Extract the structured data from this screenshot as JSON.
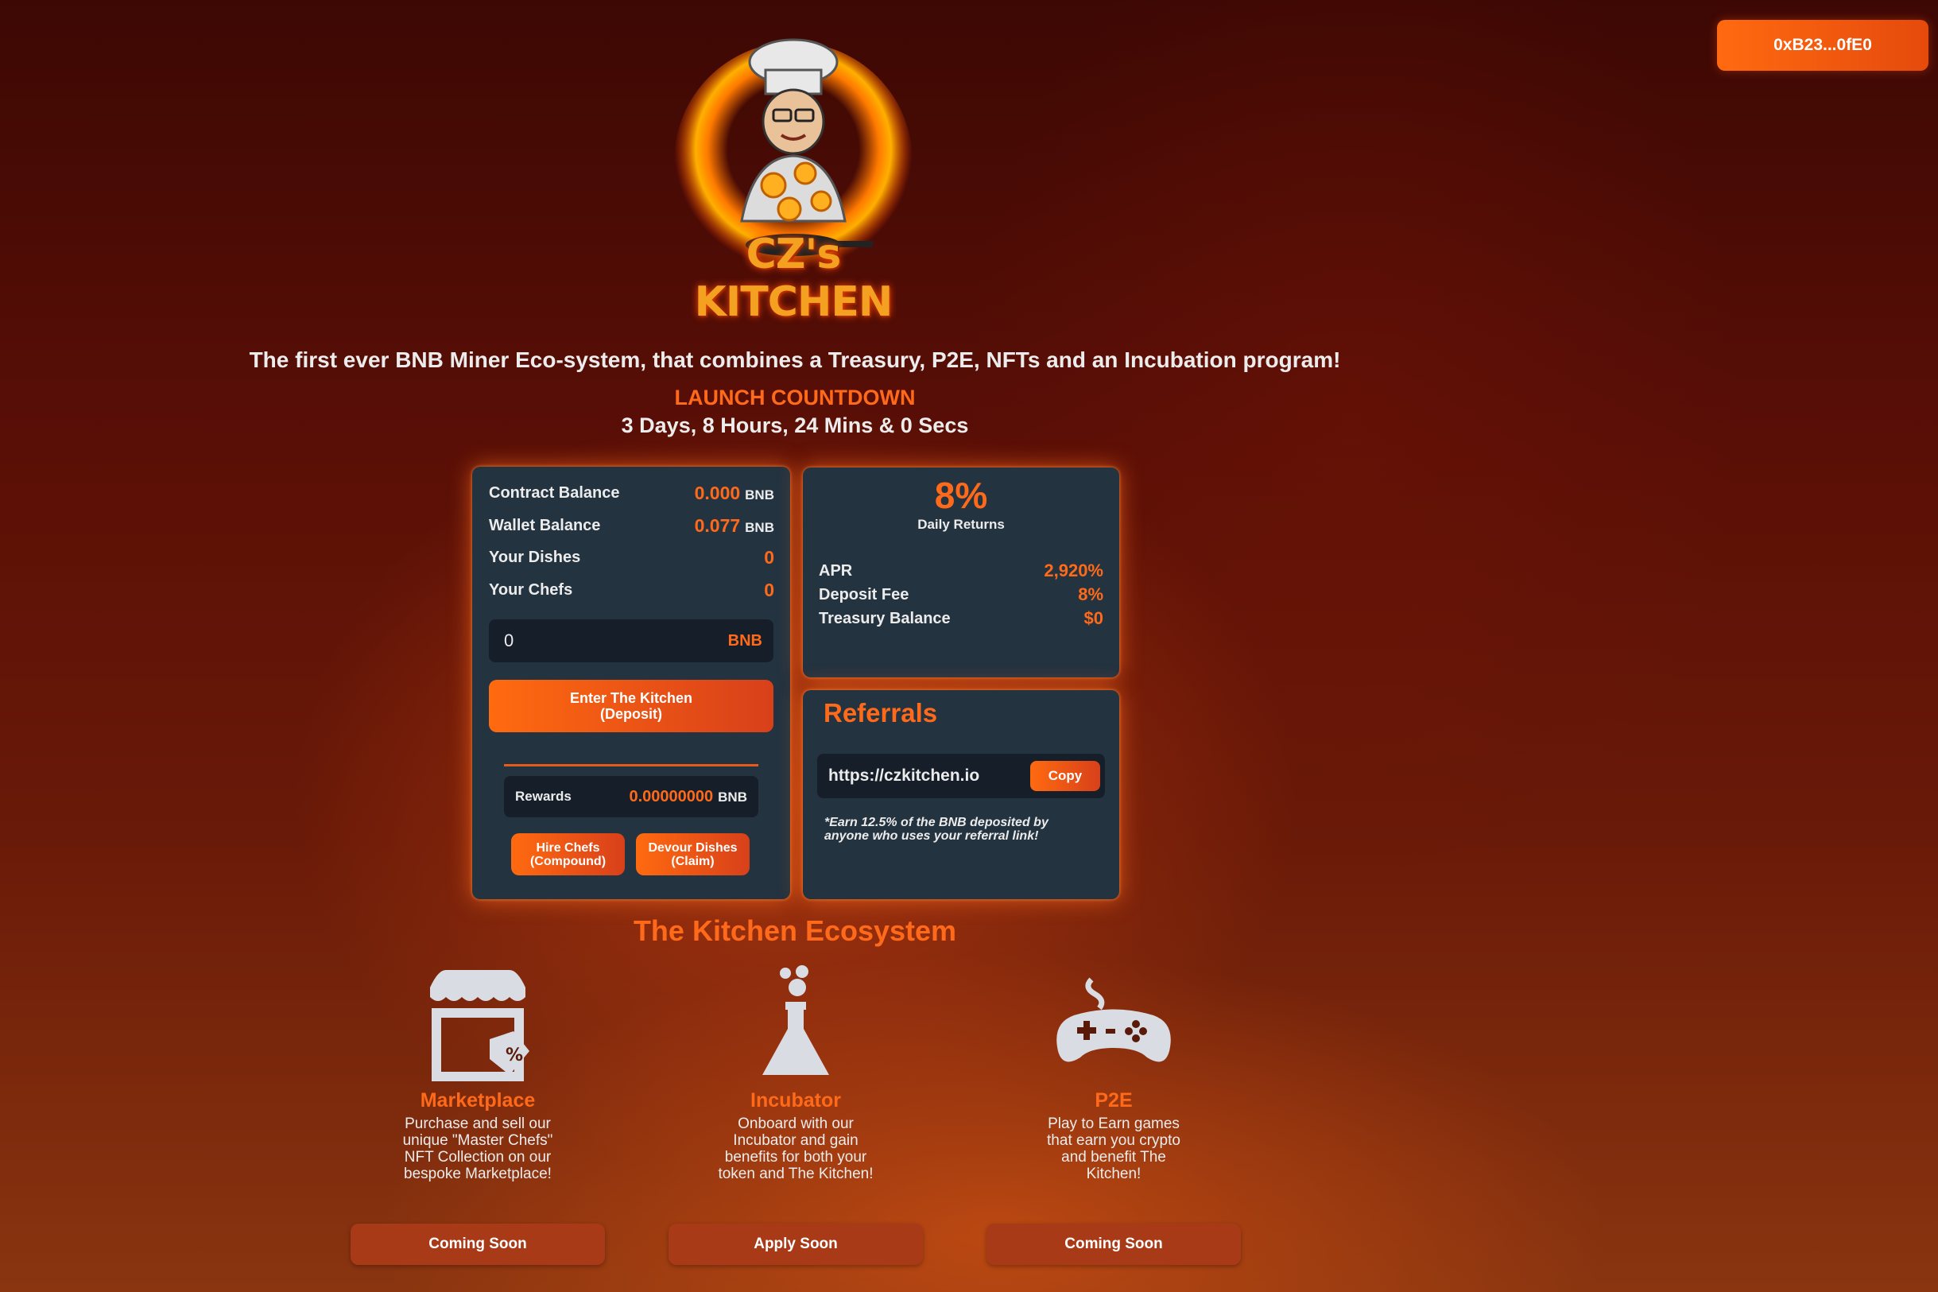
{
  "wallet": {
    "address": "0xB23...0fE0"
  },
  "logo": {
    "title": "CZ's KITCHEN"
  },
  "hero": {
    "tagline": "The first ever BNB Miner Eco-system, that combines a Treasury, P2E, NFTs and an Incubation program!",
    "countdown_label": "LAUNCH COUNTDOWN",
    "countdown_value": "3 Days, 8 Hours, 24 Mins & 0 Secs"
  },
  "stats": {
    "contract_balance_label": "Contract Balance",
    "contract_balance_value": "0.000",
    "contract_balance_unit": "BNB",
    "wallet_balance_label": "Wallet Balance",
    "wallet_balance_value": "0.077",
    "wallet_balance_unit": "BNB",
    "dishes_label": "Your Dishes",
    "dishes_value": "0",
    "chefs_label": "Your Chefs",
    "chefs_value": "0"
  },
  "deposit": {
    "input_value": "0",
    "input_unit": "BNB",
    "button_line1": "Enter The Kitchen",
    "button_line2": "(Deposit)"
  },
  "rewards": {
    "label": "Rewards",
    "value": "0.00000000",
    "unit": "BNB",
    "hire_line1": "Hire Chefs",
    "hire_line2": "(Compound)",
    "devour_line1": "Devour Dishes",
    "devour_line2": "(Claim)"
  },
  "returns": {
    "daily_pct": "8%",
    "daily_label": "Daily Returns",
    "apr_label": "APR",
    "apr_value": "2,920%",
    "fee_label": "Deposit Fee",
    "fee_value": "8%",
    "treasury_label": "Treasury Balance",
    "treasury_value": "$0"
  },
  "referrals": {
    "title": "Referrals",
    "link": "https://czkitchen.io",
    "copy_label": "Copy",
    "note": "*Earn 12.5% of the BNB deposited by anyone who uses your referral link!"
  },
  "ecosystem": {
    "title": "The Kitchen Ecosystem",
    "items": [
      {
        "icon": "storefront-icon",
        "name": "Marketplace",
        "desc": "Purchase and sell our unique \"Master Chefs\" NFT Collection on our bespoke Marketplace!",
        "button": "Coming Soon"
      },
      {
        "icon": "flask-icon",
        "name": "Incubator",
        "desc": "Onboard with our Incubator and gain benefits for both your token and The Kitchen!",
        "button": "Apply Soon"
      },
      {
        "icon": "gamepad-icon",
        "name": "P2E",
        "desc": "Play to Earn games that earn you crypto and benefit The Kitchen!",
        "button": "Coming Soon"
      }
    ]
  },
  "colors": {
    "accent": "#ff6a1a",
    "card": "#243340",
    "field": "#161f29"
  }
}
